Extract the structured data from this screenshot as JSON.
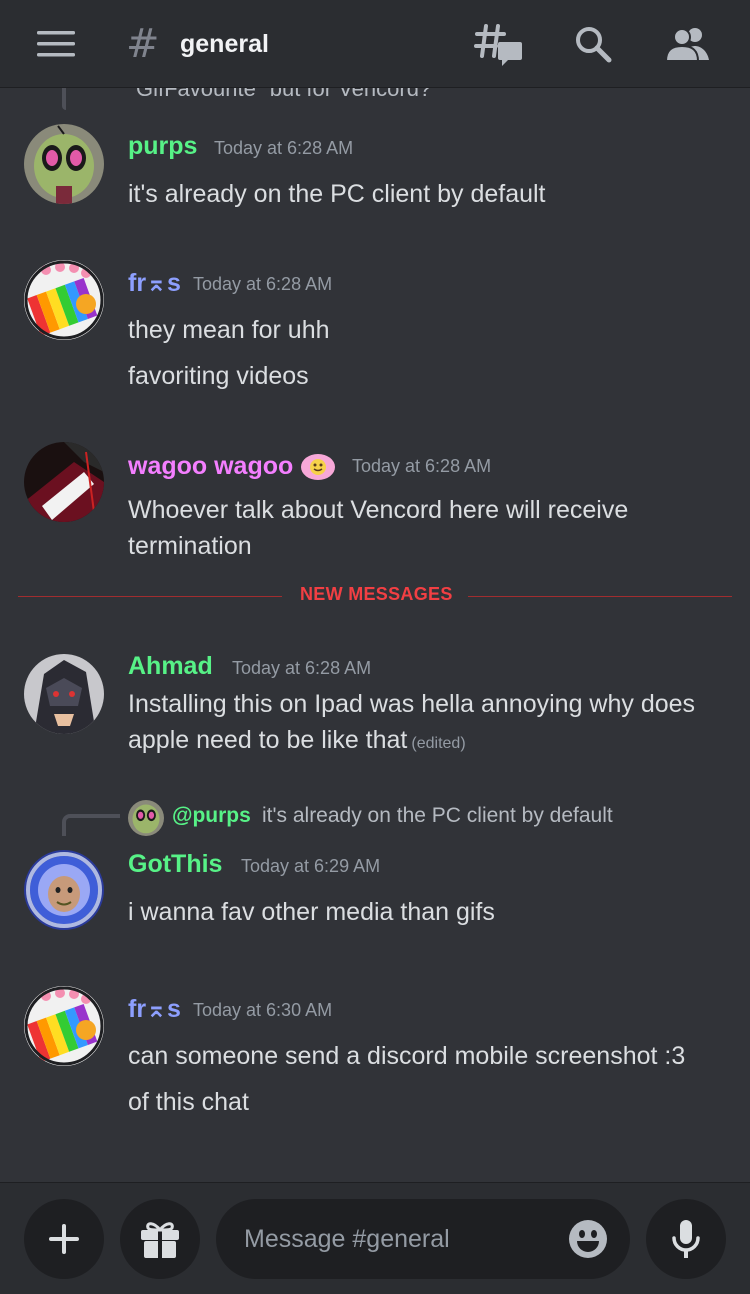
{
  "header": {
    "hash_symbol": "#",
    "channel_name": "general",
    "icons": [
      "hamburger-icon",
      "threads-icon",
      "search-icon",
      "members-icon"
    ]
  },
  "cut_off_message": "GifFavourite\" but for Vencord?",
  "messages": [
    {
      "username": "purps",
      "name_color": "#57f287",
      "timestamp": "Today at 6:28 AM",
      "lines": [
        "it's already on the PC client by default"
      ]
    },
    {
      "username": "fr⌅s",
      "name_color": "#8d9ffe",
      "timestamp": "Today at 6:28 AM",
      "lines": [
        "they mean for uhh",
        "favoriting videos"
      ]
    },
    {
      "username": "wagoo wagoo",
      "name_color": "#f47fff",
      "timestamp": "Today at 6:28 AM",
      "badge": "role-icon",
      "lines": [
        "Whoever talk about Vencord here will receive",
        "termination"
      ]
    },
    {
      "username": "Ahmad",
      "name_color": "#57f287",
      "timestamp": "Today at 6:28 AM",
      "lines": [
        "Installing this on Ipad was hella annoying why does",
        "apple need to be like that"
      ],
      "edited": "(edited)"
    },
    {
      "username": "GotThis",
      "name_color": "#57f287",
      "timestamp": "Today at 6:29 AM",
      "reply": {
        "mention": "@purps",
        "text": "it's already on the PC client by default"
      },
      "lines": [
        "i wanna fav other media than gifs"
      ]
    },
    {
      "username": "fr⌅s",
      "name_color": "#8d9ffe",
      "timestamp": "Today at 6:30 AM",
      "lines": [
        "can someone send a discord mobile screenshot :3",
        "of this chat"
      ]
    }
  ],
  "divider": {
    "label": "NEW MESSAGES",
    "color": "#f23f43"
  },
  "composer": {
    "placeholder": "Message #general",
    "icons": [
      "plus-icon",
      "gift-icon",
      "emoji-icon",
      "microphone-icon"
    ]
  }
}
